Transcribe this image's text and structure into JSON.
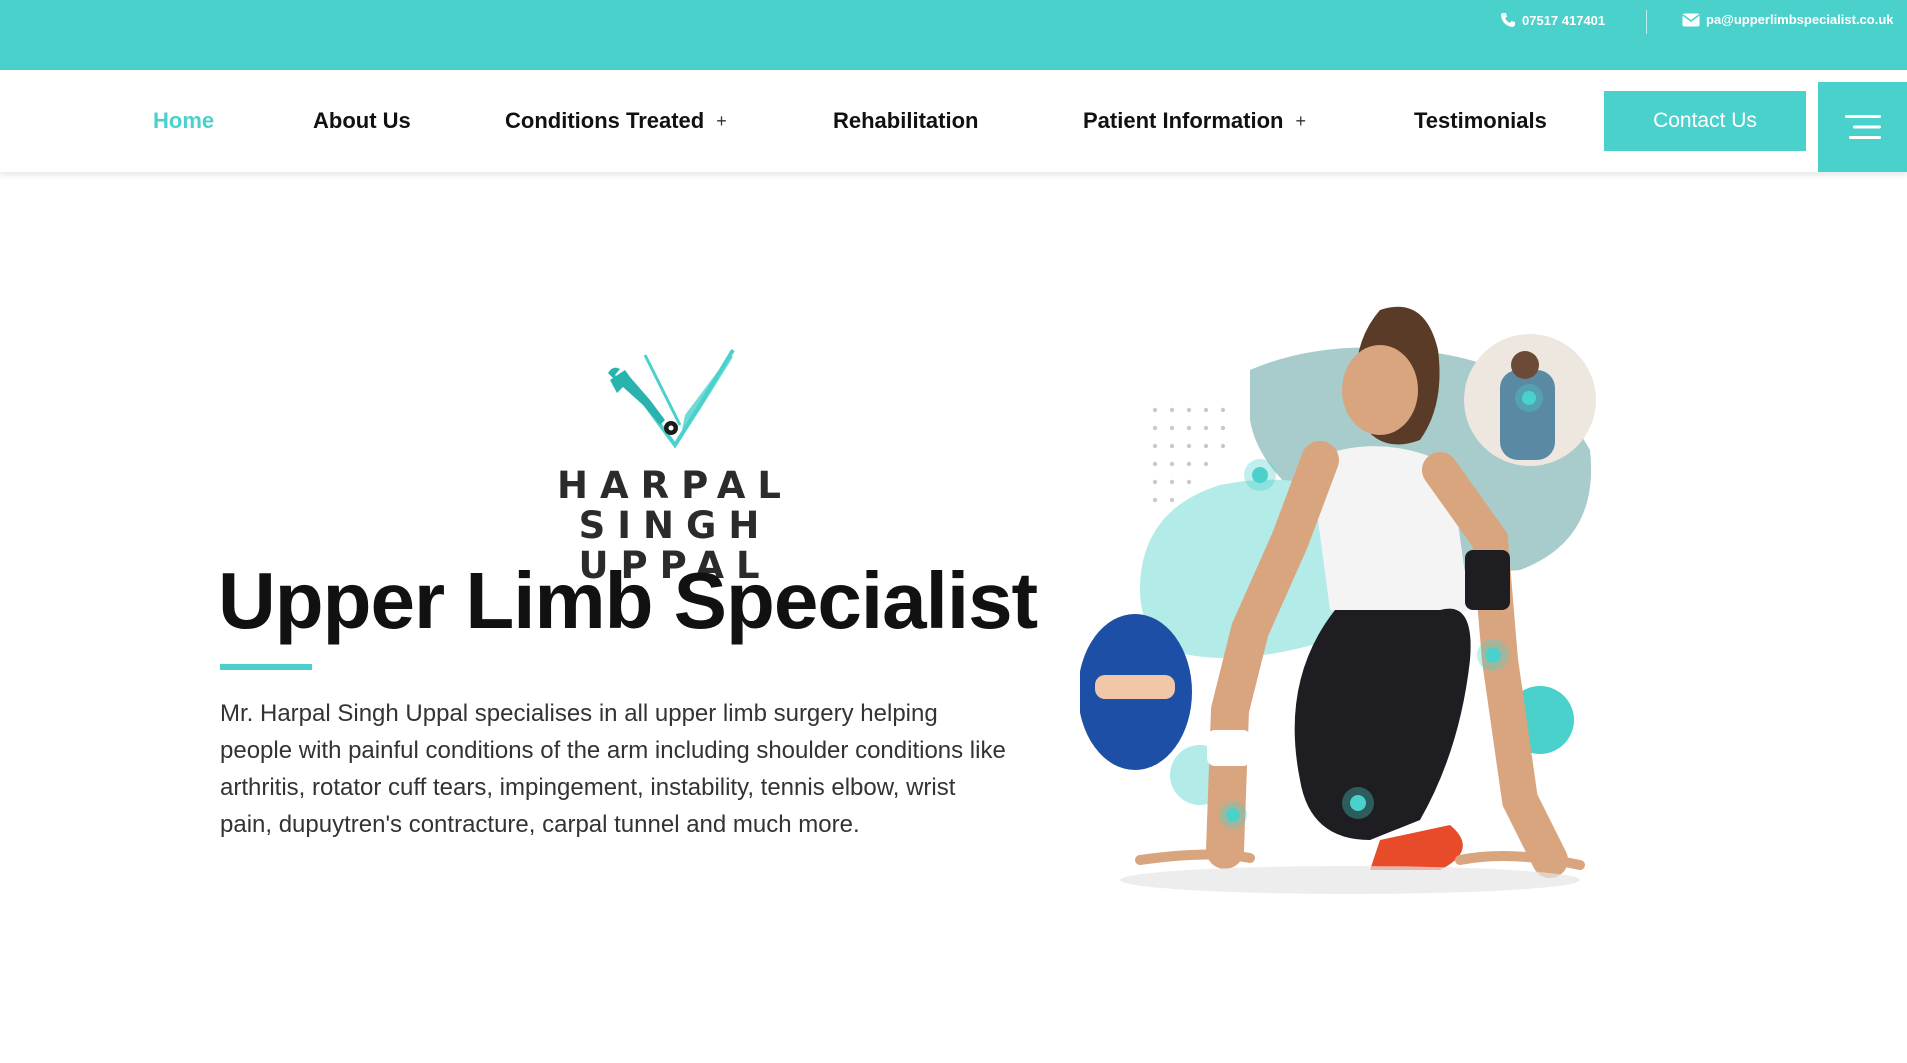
{
  "topbar": {
    "phone": "07517 417401",
    "email": "pa@upperlimbspecialist.co.uk",
    "phone_icon": "phone-icon",
    "email_icon": "envelope-icon"
  },
  "nav": {
    "items": [
      {
        "label": "Home",
        "active": true
      },
      {
        "label": "About Us"
      },
      {
        "label": "Conditions Treated",
        "has_submenu": true
      },
      {
        "label": "Rehabilitation"
      },
      {
        "label": "Patient Information",
        "has_submenu": true
      },
      {
        "label": "Testimonials"
      }
    ],
    "submenu_indicator": "+",
    "contact_button": "Contact Us",
    "menu_icon": "hamburger-menu-icon"
  },
  "hero": {
    "logo_line1": "HARPAL SINGH",
    "logo_line2": "UPPAL",
    "title": "Upper Limb Specialist",
    "description": "Mr. Harpal Singh Uppal specialises in all upper limb surgery helping people with painful conditions of the arm including shoulder conditions like arthritis, rotator cuff tears, impingement, instability, tennis elbow, wrist pain, dupuytren's contracture, carpal tunnel and much more."
  },
  "colors": {
    "accent": "#4bd1cc",
    "text": "#111111",
    "body_text": "#333333"
  }
}
